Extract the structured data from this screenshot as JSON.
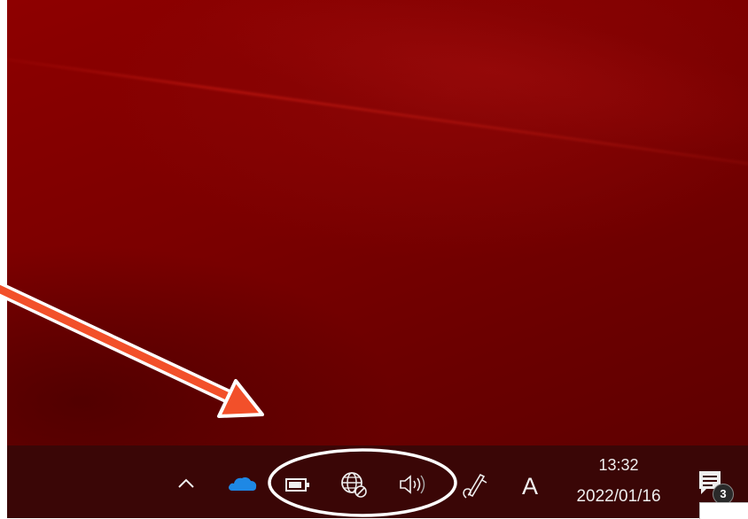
{
  "colors": {
    "desktop": "#7a0000",
    "taskbar": "#3a0606",
    "arrow": "#f2502a",
    "highlight_ring": "#ffffff",
    "onedrive": "#1e88e5",
    "tray_icon": "#eeeeee"
  },
  "taskbar": {
    "tray": {
      "overflow_icon": "chevron-up-icon",
      "onedrive_icon": "cloud-icon",
      "battery_icon": "battery-icon",
      "network_icon": "globe-no-connection-icon",
      "volume_icon": "speaker-icon",
      "pen_icon": "pen-ink-icon",
      "ime_label": "A"
    },
    "clock": {
      "time": "13:32",
      "date": "2022/01/16"
    },
    "notifications": {
      "icon": "action-center-icon",
      "count": "3"
    }
  }
}
